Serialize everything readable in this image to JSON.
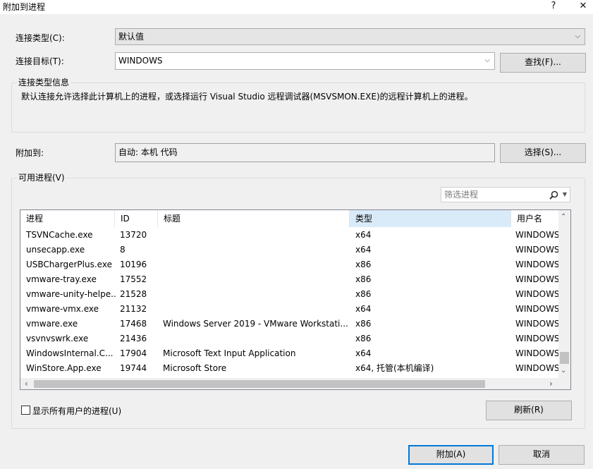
{
  "window": {
    "title": "附加到进程",
    "help": "?",
    "close": "✕"
  },
  "connection_type": {
    "label": "连接类型(C):",
    "value": "默认值"
  },
  "connection_target": {
    "label": "连接目标(T):",
    "value": "WINDOWS",
    "find_button": "查找(F)..."
  },
  "info": {
    "title": "连接类型信息",
    "text": "默认连接允许选择此计算机上的进程，或选择运行 Visual Studio 远程调试器(MSVSMON.EXE)的远程计算机上的进程。"
  },
  "attach_to": {
    "label": "附加到:",
    "value": "自动: 本机 代码",
    "select_button": "选择(S)..."
  },
  "processes": {
    "group_label": "可用进程(V)",
    "filter_placeholder": "筛选进程",
    "columns": [
      "进程",
      "ID",
      "标题",
      "类型",
      "用户名"
    ],
    "rows": [
      [
        "TSVNCache.exe",
        "13720",
        "",
        "x64",
        "WINDOWS"
      ],
      [
        "unsecapp.exe",
        "8",
        "",
        "x64",
        "WINDOWS"
      ],
      [
        "USBChargerPlus.exe",
        "10196",
        "",
        "x86",
        "WINDOWS"
      ],
      [
        "vmware-tray.exe",
        "17552",
        "",
        "x86",
        "WINDOWS"
      ],
      [
        "vmware-unity-helpe...",
        "21528",
        "",
        "x86",
        "WINDOWS"
      ],
      [
        "vmware-vmx.exe",
        "21132",
        "",
        "x64",
        "WINDOWS"
      ],
      [
        "vmware.exe",
        "17468",
        "Windows Server 2019 - VMware Workstati...",
        "x86",
        "WINDOWS"
      ],
      [
        "vsvnvswrk.exe",
        "21436",
        "",
        "x86",
        "WINDOWS"
      ],
      [
        "WindowsInternal.C...",
        "17904",
        "Microsoft Text Input Application",
        "x64",
        "WINDOWS"
      ],
      [
        "WinStore.App.exe",
        "19744",
        "Microsoft Store",
        "x64, 托管(本机编译)",
        "WINDOWS"
      ]
    ],
    "show_all_users": "显示所有用户的进程(U)",
    "refresh_button": "刷新(R)"
  },
  "footer": {
    "attach_button": "附加(A)",
    "cancel_button": "取消"
  }
}
